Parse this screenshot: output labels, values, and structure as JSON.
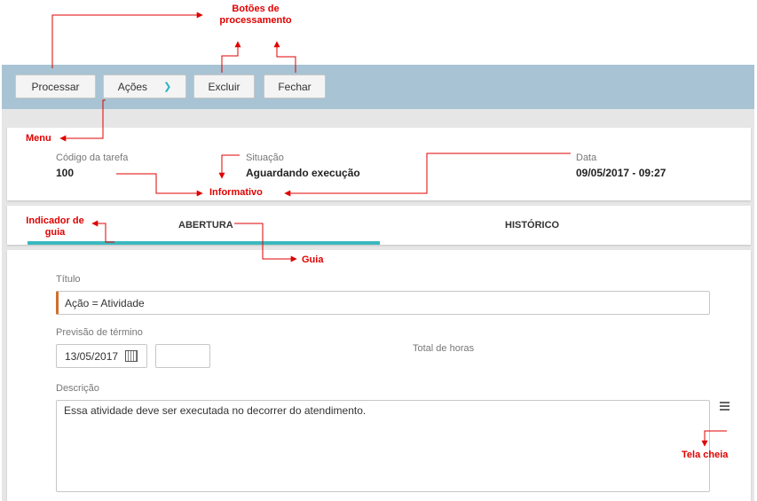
{
  "annotations": {
    "processing_buttons": "Botões de processamento",
    "menu": "Menu",
    "informative": "Informativo",
    "tab_indicator": "Indicador de guia",
    "tab": "Guia",
    "full_screen": "Tela cheia"
  },
  "toolbar": {
    "process_label": "Processar",
    "actions_label": "Ações",
    "delete_label": "Excluir",
    "close_label": "Fechar"
  },
  "info": {
    "task_code_label": "Código da tarefa",
    "task_code_value": "100",
    "status_label": "Situação",
    "status_value": "Aguardando execução",
    "date_label": "Data",
    "date_value": "09/05/2017 - 09:27"
  },
  "tabs": [
    {
      "label": "ABERTURA",
      "active": true
    },
    {
      "label": "HISTÓRICO",
      "active": false
    }
  ],
  "form": {
    "title_label": "Título",
    "title_value": "Ação = Atividade",
    "due_label": "Previsão de término",
    "due_value": "13/05/2017",
    "hours_value": "",
    "total_hours_label": "Total de horas",
    "description_label": "Descrição",
    "description_value": "Essa atividade deve ser executada no decorrer do atendimento."
  },
  "colors": {
    "toolbar_bg": "#a8c3d3",
    "accent": "#3bb8be",
    "required_marker": "#d0702c",
    "annotation": "#e00000"
  }
}
